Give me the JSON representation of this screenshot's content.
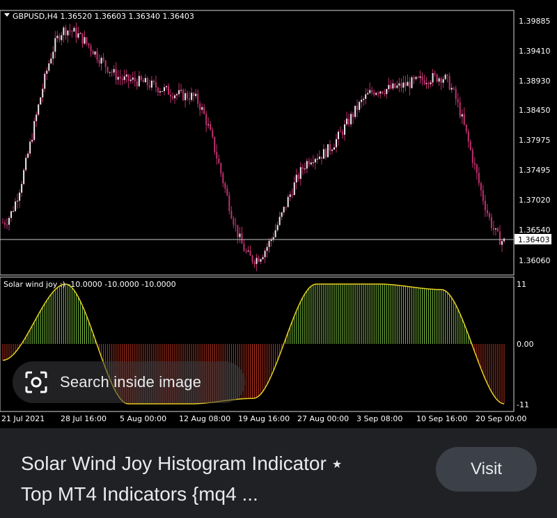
{
  "main_chart": {
    "header": "GBPUSD,H4  1.36520 1.36603 1.36340 1.36403",
    "price_labels": [
      "1.39885",
      "1.39410",
      "1.38930",
      "1.38450",
      "1.37975",
      "1.37495",
      "1.37020",
      "1.36540",
      "1.36060"
    ],
    "current_price": "1.36403"
  },
  "indicator": {
    "header": "Solar wind joy :) -10.0000 -10.0000 -10.0000",
    "level_labels": [
      "11",
      "0.00",
      "-11"
    ]
  },
  "time_labels": [
    "21 Jul 2021",
    "28 Jul 16:00",
    "5 Aug 00:00",
    "12 Aug 08:00",
    "19 Aug 16:00",
    "27 Aug 00:00",
    "3 Sep 08:00",
    "10 Sep 16:00",
    "20 Sep 00:00"
  ],
  "lens": {
    "label": "Search inside image",
    "icon": "lens-icon"
  },
  "result": {
    "title_line1": "Solar Wind Joy Histogram Indicator",
    "title_line2": "Top MT4 Indicators {mq4 ...",
    "visit_label": "Visit"
  },
  "colors": {
    "candle": "#c0306e",
    "bull_bar": "#7fbf3f",
    "bear_bar": "#b8341f",
    "line": "#e8d020",
    "background": "#000000"
  },
  "chart_data": {
    "type": "line",
    "title": "GBPUSD,H4",
    "x": [
      "21 Jul 2021",
      "28 Jul 16:00",
      "5 Aug 00:00",
      "12 Aug 08:00",
      "19 Aug 16:00",
      "27 Aug 00:00",
      "3 Sep 08:00",
      "10 Sep 16:00",
      "20 Sep 00:00"
    ],
    "series": [
      {
        "name": "GBPUSD,H4",
        "values": [
          1.367,
          1.3975,
          1.3895,
          1.387,
          1.3612,
          1.3775,
          1.388,
          1.39,
          1.364
        ]
      },
      {
        "name": "Solar wind joy :)",
        "values": [
          -3,
          11,
          -11,
          -11,
          -10,
          11,
          11,
          10,
          -11
        ]
      }
    ],
    "ylim": [
      1.359,
      1.4
    ],
    "indicator_ylim": [
      -11,
      11
    ],
    "grid": false
  }
}
